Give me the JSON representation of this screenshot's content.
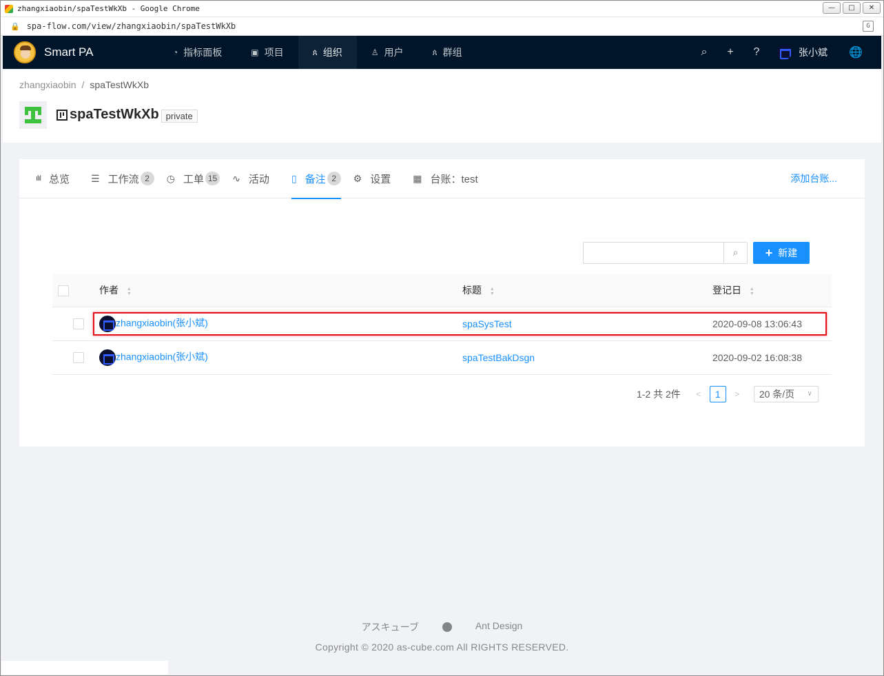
{
  "browser": {
    "window_title": "zhangxiaobin/spaTestWkXb - Google Chrome",
    "url": "spa-flow.com/view/zhangxiaobin/spaTestWkXb",
    "controls": {
      "minimize": "—",
      "maximize": "□",
      "close": "✕"
    }
  },
  "header": {
    "brand": "Smart PA",
    "nav": [
      {
        "label": "指标面板",
        "icon": "dashboard-icon",
        "glyph": "◔"
      },
      {
        "label": "项目",
        "icon": "project-icon",
        "glyph": "▣"
      },
      {
        "label": "组织",
        "icon": "organization-icon",
        "glyph": "ጰ"
      },
      {
        "label": "用户",
        "icon": "user-icon",
        "glyph": "♙"
      },
      {
        "label": "群组",
        "icon": "group-icon",
        "glyph": "ጰ"
      }
    ],
    "active_nav": "组织",
    "icons": {
      "search": "⌕",
      "add": "+",
      "help": "?",
      "language": "🌐"
    },
    "username": "张小斌"
  },
  "breadcrumb": {
    "root": "zhangxiaobin",
    "separator": "/",
    "current": "spaTestWkXb"
  },
  "project": {
    "title": "spaTestWkXb",
    "visibility": "private"
  },
  "tabs": [
    {
      "label": "总览",
      "glyph": "ılıl"
    },
    {
      "label": "工作流",
      "glyph": "☰",
      "badge": "2"
    },
    {
      "label": "工单",
      "glyph": "◷",
      "badge": "15"
    },
    {
      "label": "活动",
      "glyph": "∿"
    },
    {
      "label": "备注",
      "glyph": "▯",
      "badge": "2"
    },
    {
      "label": "设置",
      "glyph": "⚙"
    },
    {
      "label": "台账：test",
      "glyph": "▦"
    }
  ],
  "active_tab": "备注",
  "add_ledger": "添加台账...",
  "search": {
    "placeholder": "",
    "icon": "⌕"
  },
  "new_button": {
    "label": "新建",
    "icon": "+"
  },
  "table": {
    "columns": {
      "author": "作者",
      "title": "标题",
      "date": "登记日"
    },
    "rows": [
      {
        "author": "zhangxiaobin(张小斌)",
        "title": "spaSysTest",
        "date": "2020-09-08 13:06:43"
      },
      {
        "author": "zhangxiaobin(张小斌)",
        "title": "spaTestBakDsgn",
        "date": "2020-09-02 16:08:38"
      }
    ]
  },
  "pagination": {
    "total_text": "1-2 共 2件",
    "prev": "<",
    "current": "1",
    "next": ">",
    "page_size": "20 条/页",
    "chevron": "∨"
  },
  "footer": {
    "link1": "アスキューブ",
    "link2": "Ant Design",
    "copyright": "Copyright © 2020 as-cube.com All RIGHTS RESERVED."
  },
  "colors": {
    "primary": "#1890ff",
    "header_bg": "#001529",
    "highlight": "#e3101a"
  }
}
